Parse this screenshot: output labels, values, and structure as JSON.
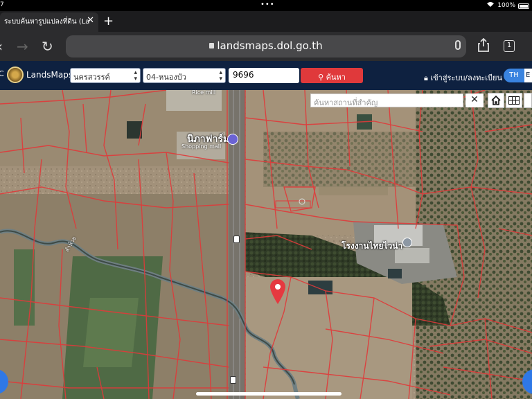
{
  "status": {
    "time": "7",
    "battery": "100%"
  },
  "browser": {
    "tab_title": "ระบบค้นหารูปแปลงที่ดิน (La",
    "url": "landsmaps.dol.go.th",
    "tab_count": "1"
  },
  "app": {
    "name": "LandsMaps",
    "province": "นครสวรรค์",
    "district": "04-หนองบัว",
    "parcel_number": "9696",
    "search_label": "ค้นหา",
    "login_label": "เข้าสู่ระบบ/ลงทะเบียน",
    "lang_active": "TH",
    "lang_other": "E"
  },
  "map": {
    "poi_search_placeholder": "ค้นหาสถานที่สำคัญ",
    "labels": {
      "rice_mill": "Rice mill",
      "shop": "นิภาฟาร์ม",
      "shop_sub": "Shopping mall",
      "factory": "โรงงานไทยไวน่า",
      "stream": "ลำห้วย"
    },
    "colors": {
      "boundary": "#e03a3a",
      "marker": "#e53940",
      "brand": "#0e2140"
    }
  }
}
